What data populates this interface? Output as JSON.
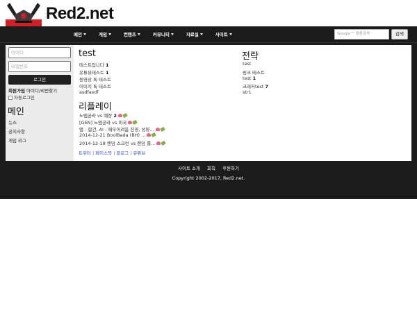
{
  "header": {
    "logo_text": "Red2.net"
  },
  "nav": {
    "items": [
      "메인",
      "게임",
      "컨텐츠",
      "커뮤니티",
      "자료실",
      "사이트"
    ]
  },
  "search": {
    "placeholder": "Google™ 맞춤검색",
    "button": "검색"
  },
  "login": {
    "id_placeholder": "아이디",
    "pw_placeholder": "비밀번호",
    "button": "로그인",
    "signup": "회원가입",
    "find": "아이디/비번찾기",
    "autologin": "자동로그인"
  },
  "sidebar": {
    "title": "메인",
    "links": [
      "뉴스",
      "공지사항",
      "게임 리그"
    ]
  },
  "test_section": {
    "title": "test",
    "posts": [
      {
        "text": "테스트입니다",
        "count": "1"
      },
      {
        "text": "유튜뷰테스트",
        "count": "1"
      },
      {
        "text": "동영상 톡 테스트",
        "count": ""
      },
      {
        "text": "이미지 톡 테스트",
        "count": ""
      },
      {
        "text": "asdfasdf",
        "count": ""
      }
    ]
  },
  "strategy_section": {
    "title": "전략",
    "posts": [
      {
        "text": "test",
        "count": ""
      },
      {
        "text": "링크 테스트",
        "count": ""
      },
      {
        "text": "test",
        "count": "1"
      },
      {
        "text": "크래커test",
        "count": "7"
      },
      {
        "text": "str1",
        "count": ""
      }
    ]
  },
  "replay_section": {
    "title": "리플레이",
    "posts": [
      {
        "text": "노템궁라 vs 예장",
        "count": "2"
      },
      {
        "text": "[GEN] 노템궁라 vs 미국",
        "count": ""
      },
      {
        "text": "앱 - 합건, AI - 매우어려움 진영, 성향...",
        "count": ""
      },
      {
        "text": "2014-12-21 BoolBada (BH) ...",
        "count": ""
      },
      {
        "text": "2014-12-18 랜덤 스크린 vs 랜덤 롤...",
        "count": ""
      }
    ]
  },
  "social": {
    "links": [
      "트위터",
      "페이스북",
      "블로그",
      "유튜브"
    ]
  },
  "footer": {
    "links": [
      "사이트 소개",
      "회칙",
      "후원하기"
    ],
    "copyright": "Copyright 2002-2017, Red2.net."
  },
  "colors": {
    "nav_bg": "#1b1b1b",
    "brand_red": "#d21f26",
    "link_blue": "#3355cc"
  }
}
